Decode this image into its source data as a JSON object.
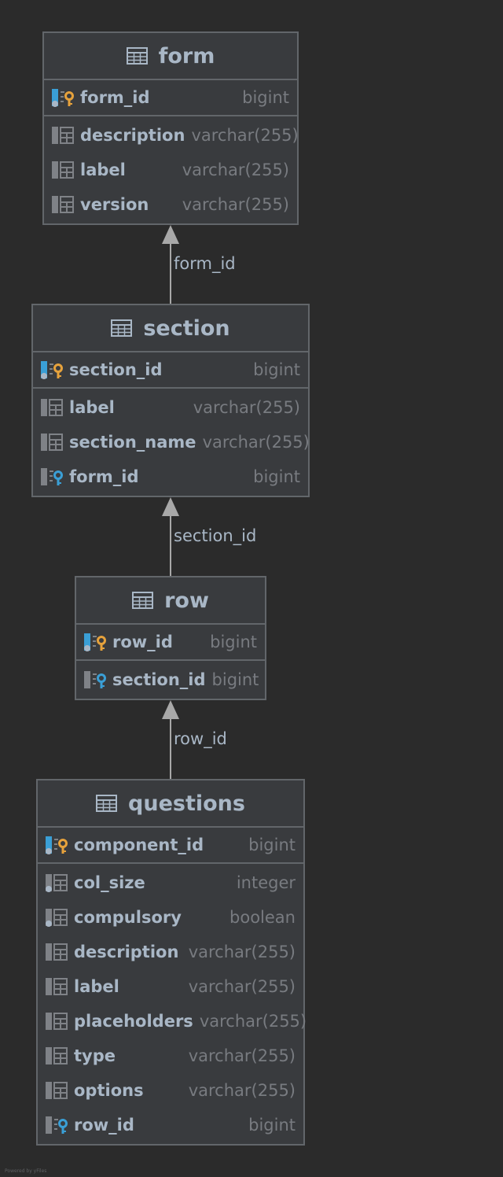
{
  "colors": {
    "background": "#2b2b2b",
    "entity_bg": "#393b3e",
    "border": "#62666a",
    "text": "#a9b7c6",
    "type_text": "#787b80",
    "primary_key": "#e6a23c",
    "foreign_key": "#3a9fd6",
    "column_icon": "#7f8287",
    "arrow": "#a8a8a8"
  },
  "tables": {
    "form": {
      "name": "form",
      "pk": {
        "name": "form_id",
        "type": "bigint",
        "icon": "primary-key-icon"
      },
      "columns": [
        {
          "name": "description",
          "type": "varchar(255)",
          "icon": "column-icon"
        },
        {
          "name": "label",
          "type": "varchar(255)",
          "icon": "column-icon"
        },
        {
          "name": "version",
          "type": "varchar(255)",
          "icon": "column-icon"
        }
      ]
    },
    "section": {
      "name": "section",
      "pk": {
        "name": "section_id",
        "type": "bigint",
        "icon": "primary-key-icon"
      },
      "columns": [
        {
          "name": "label",
          "type": "varchar(255)",
          "icon": "column-icon"
        },
        {
          "name": "section_name",
          "type": "varchar(255)",
          "icon": "column-icon"
        },
        {
          "name": "form_id",
          "type": "bigint",
          "icon": "foreign-key-icon"
        }
      ]
    },
    "row": {
      "name": "row",
      "pk": {
        "name": "row_id",
        "type": "bigint",
        "icon": "primary-key-icon"
      },
      "columns": [
        {
          "name": "section_id",
          "type": "bigint",
          "icon": "foreign-key-icon"
        }
      ]
    },
    "questions": {
      "name": "questions",
      "pk": {
        "name": "component_id",
        "type": "bigint",
        "icon": "primary-key-icon"
      },
      "columns": [
        {
          "name": "col_size",
          "type": "integer",
          "icon": "not-null-column-icon"
        },
        {
          "name": "compulsory",
          "type": "boolean",
          "icon": "not-null-column-icon"
        },
        {
          "name": "description",
          "type": "varchar(255)",
          "icon": "column-icon"
        },
        {
          "name": "label",
          "type": "varchar(255)",
          "icon": "column-icon"
        },
        {
          "name": "placeholders",
          "type": "varchar(255)",
          "icon": "column-icon"
        },
        {
          "name": "type",
          "type": "varchar(255)",
          "icon": "column-icon"
        },
        {
          "name": "options",
          "type": "varchar(255)",
          "icon": "column-icon"
        },
        {
          "name": "row_id",
          "type": "bigint",
          "icon": "foreign-key-icon"
        }
      ]
    }
  },
  "relations": [
    {
      "label": "form_id",
      "from": "section",
      "to": "form"
    },
    {
      "label": "section_id",
      "from": "row",
      "to": "section"
    },
    {
      "label": "row_id",
      "from": "questions",
      "to": "row"
    }
  ],
  "footer": "Powered by yFiles"
}
